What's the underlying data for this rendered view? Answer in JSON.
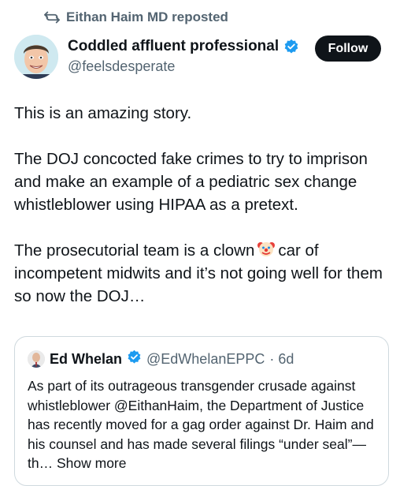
{
  "repost": {
    "icon": "repost-icon",
    "text": "Eithan Haim MD reposted"
  },
  "author": {
    "name": "Coddled affluent professional",
    "handle": "@feelsdesperate",
    "verified_icon": "verified-badge-icon"
  },
  "follow_label": "Follow",
  "post": {
    "p1": "This is an amazing story.",
    "p2": "The DOJ concocted fake crimes to try to imprison and make an example of a pediatric sex change whistleblower using HIPAA as a pretext.",
    "p3_before": "The prosecutorial team is a clown",
    "p3_after": "car of incompetent midwits and it’s not going well for them so now the DOJ…"
  },
  "quote": {
    "name": "Ed Whelan",
    "handle": "@EdWhelanEPPC",
    "time": "· 6d",
    "text": "As part of its outrageous transgender crusade against whistleblower @EithanHaim, the Department of Justice has recently moved for a gag order against Dr. Haim and his counsel and has made several filings “under seal”—th…",
    "show_more": "Show more"
  },
  "colors": {
    "text": "#0f1419",
    "secondary": "#536471",
    "verified": "#1d9bf0",
    "border": "#cfd9de"
  }
}
